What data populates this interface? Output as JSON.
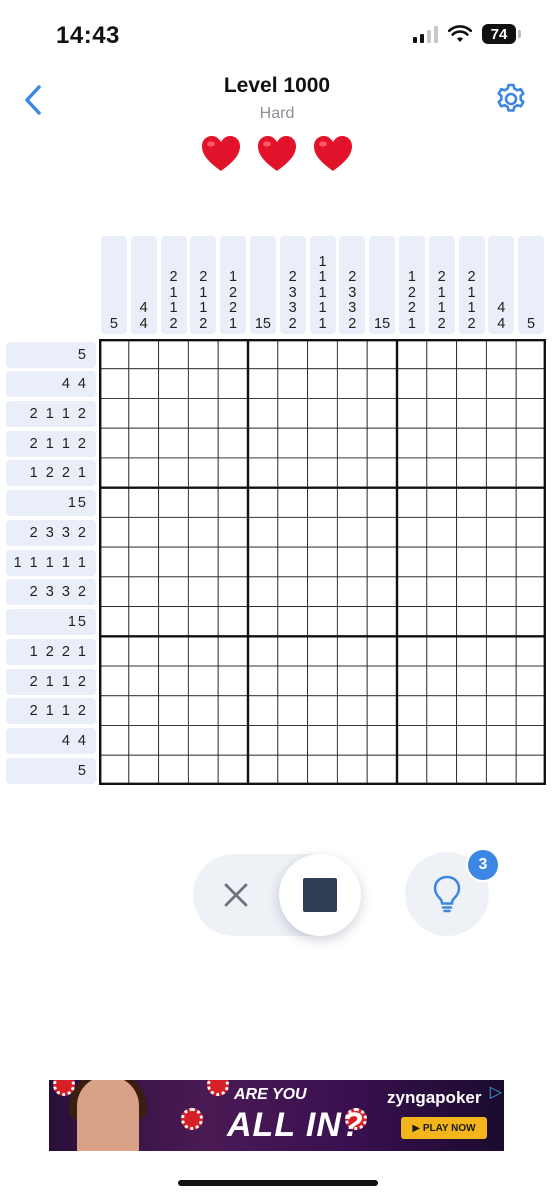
{
  "status_bar": {
    "time": "14:43",
    "battery": "74"
  },
  "header": {
    "title": "Level 1000",
    "subtitle": "Hard",
    "lives": 3
  },
  "column_clues": [
    [
      "5"
    ],
    [
      "4",
      "4"
    ],
    [
      "2",
      "1",
      "1",
      "2"
    ],
    [
      "2",
      "1",
      "1",
      "2"
    ],
    [
      "1",
      "2",
      "2",
      "1"
    ],
    [
      "15"
    ],
    [
      "2",
      "3",
      "3",
      "2"
    ],
    [
      "1",
      "1",
      "1",
      "1",
      "1"
    ],
    [
      "2",
      "3",
      "3",
      "2"
    ],
    [
      "15"
    ],
    [
      "1",
      "2",
      "2",
      "1"
    ],
    [
      "2",
      "1",
      "1",
      "2"
    ],
    [
      "2",
      "1",
      "1",
      "2"
    ],
    [
      "4",
      "4"
    ],
    [
      "5"
    ]
  ],
  "row_clues": [
    "5",
    "4 4",
    "2 1 1 2",
    "2 1 1 2",
    "1 2 2 1",
    "15",
    "2 3 3 2",
    "1 1 1 1 1",
    "2 3 3 2",
    "15",
    "1 2 2 1",
    "2 1 1 2",
    "2 1 1 2",
    "4 4",
    "5"
  ],
  "grid": {
    "rows": 15,
    "cols": 15,
    "block": 5
  },
  "controls": {
    "mode": "fill",
    "hints_count": "3"
  },
  "ad": {
    "headline_1": "ARE YOU",
    "headline_2": "ALL IN?",
    "brand": "zyngapoker",
    "cta": "▶ PLAY NOW"
  },
  "colors": {
    "accent": "#3d87e4",
    "heart": "#e3122b",
    "clue_bg": "#e9eef8",
    "fill_square": "#2f3d55"
  },
  "icons": {
    "back": "chevron-left-icon",
    "settings": "gear-icon",
    "cross": "x-icon",
    "hint": "lightbulb-icon"
  }
}
